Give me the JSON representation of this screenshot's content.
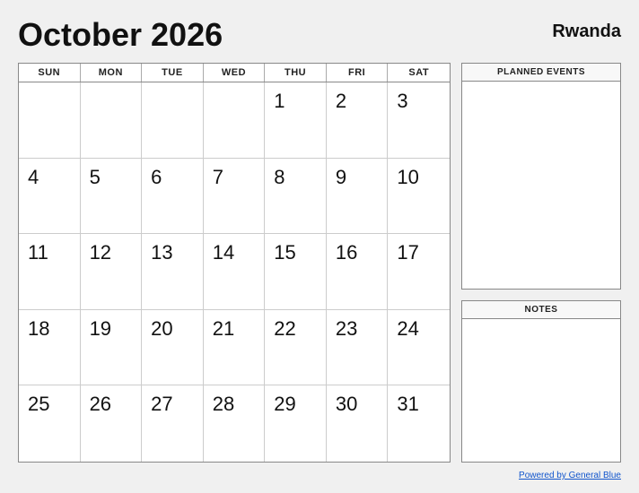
{
  "header": {
    "title": "October 2026",
    "country": "Rwanda"
  },
  "calendar": {
    "day_headers": [
      "SUN",
      "MON",
      "TUE",
      "WED",
      "THU",
      "FRI",
      "SAT"
    ],
    "weeks": [
      [
        "",
        "",
        "",
        "",
        "1",
        "2",
        "3"
      ],
      [
        "4",
        "5",
        "6",
        "7",
        "8",
        "9",
        "10"
      ],
      [
        "11",
        "12",
        "13",
        "14",
        "15",
        "16",
        "17"
      ],
      [
        "18",
        "19",
        "20",
        "21",
        "22",
        "23",
        "24"
      ],
      [
        "25",
        "26",
        "27",
        "28",
        "29",
        "30",
        "31"
      ]
    ]
  },
  "sidebar": {
    "planned_events_label": "PLANNED EVENTS",
    "notes_label": "NOTES"
  },
  "footer": {
    "link_text": "Powered by General Blue"
  }
}
